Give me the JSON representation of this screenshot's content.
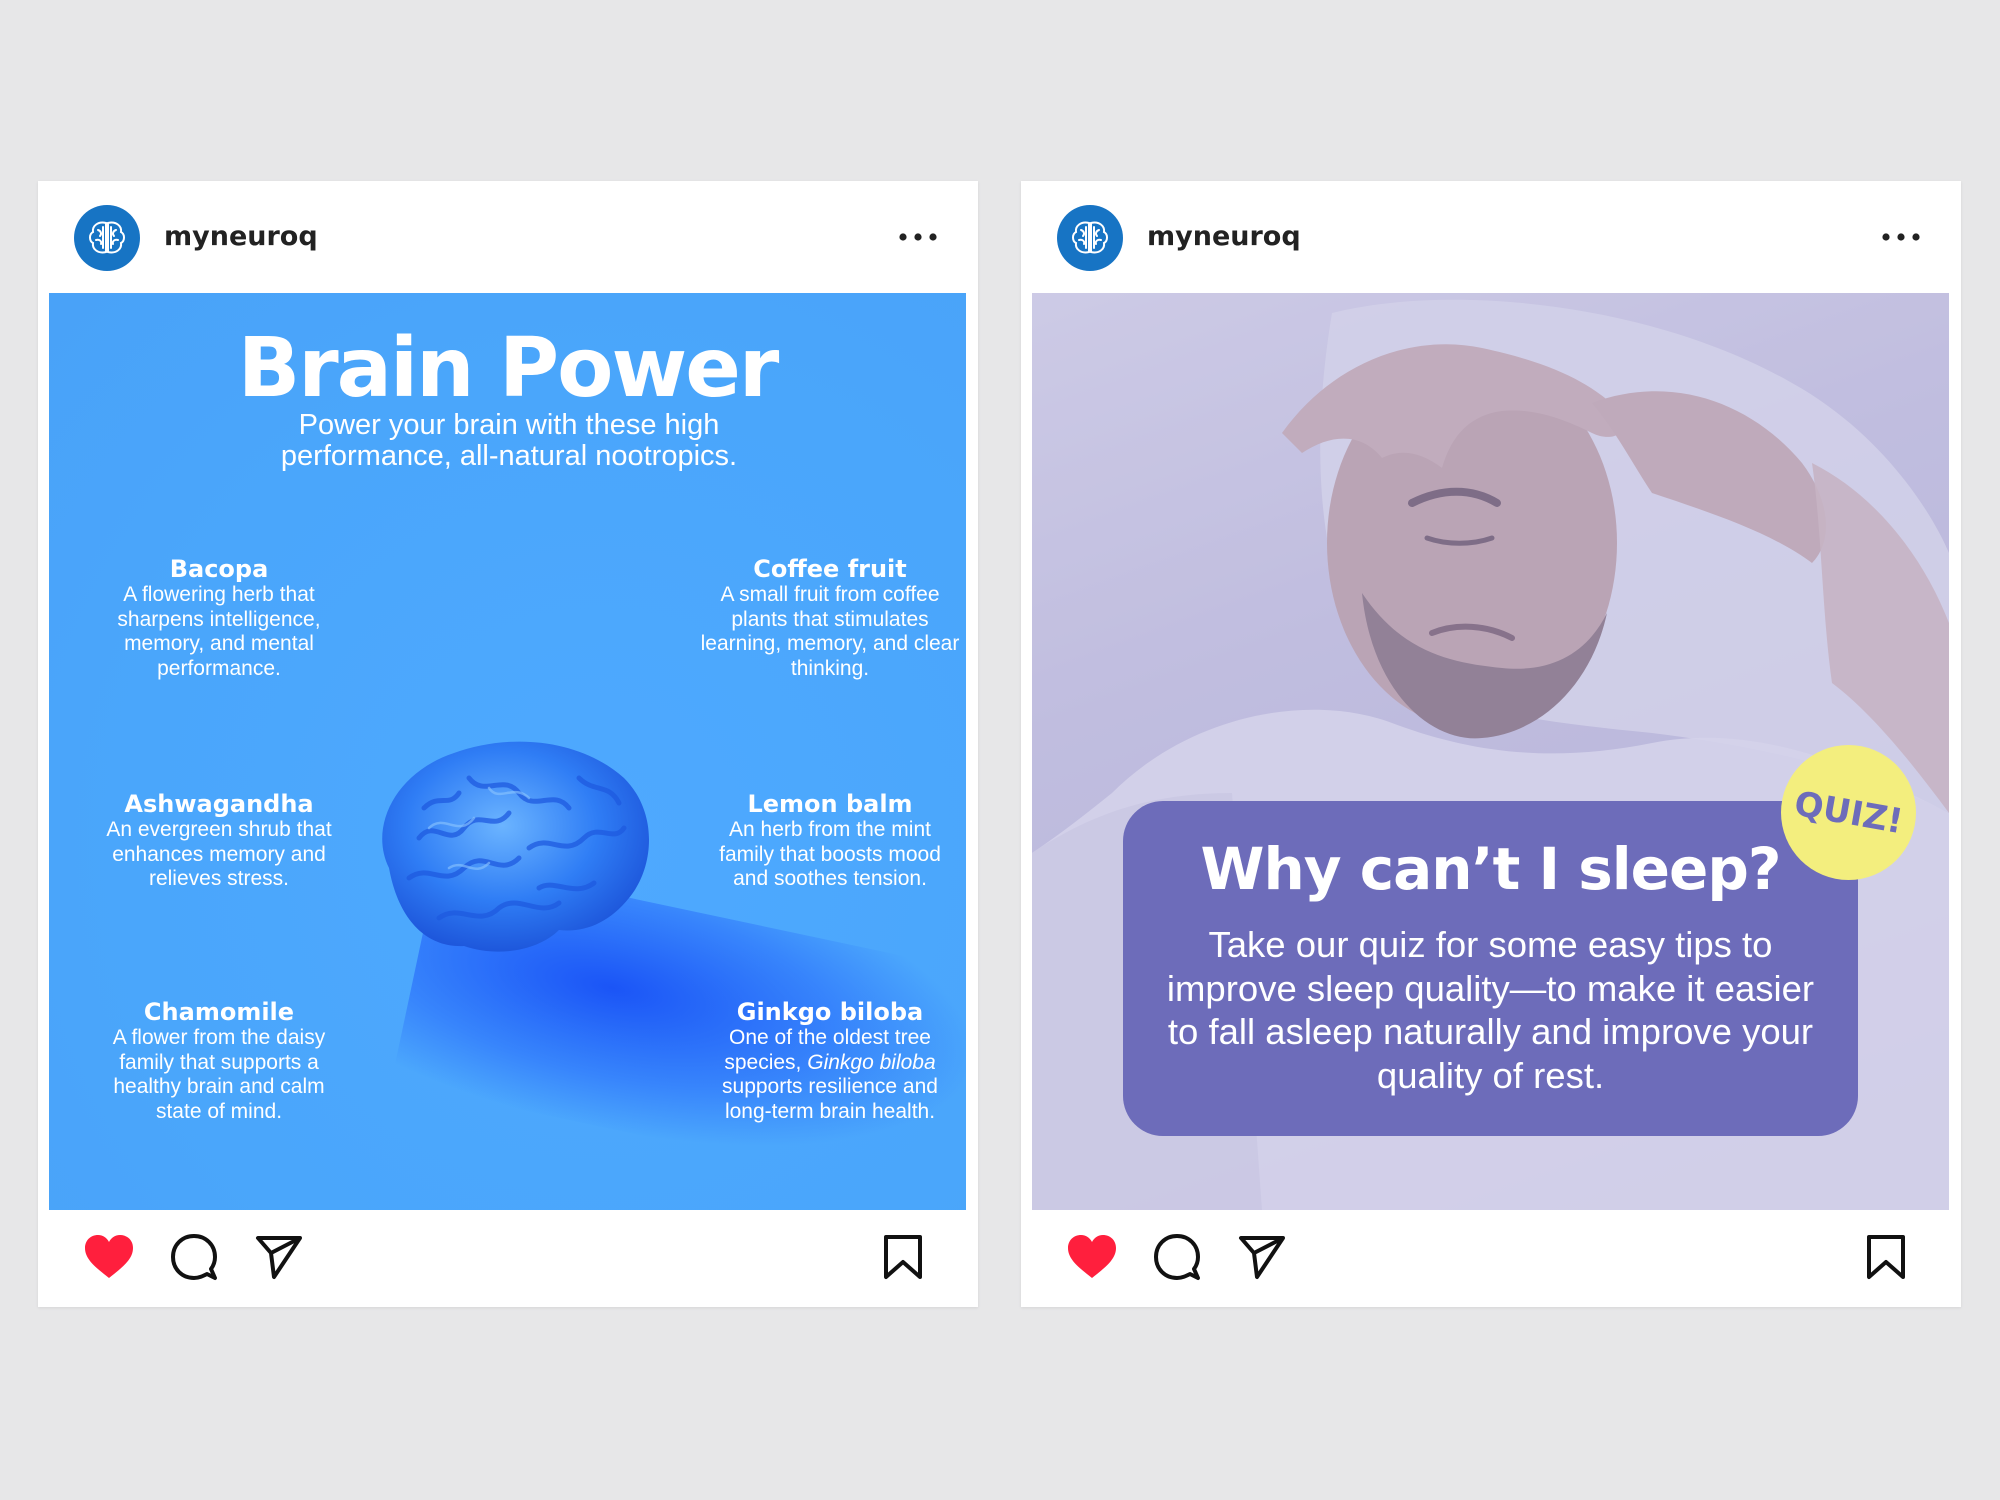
{
  "posts": [
    {
      "username": "myneuroq",
      "title": "Brain Power",
      "subtitle": "Power your brain with these high performance, all-natural nootropics.",
      "ingredients": [
        {
          "name": "Bacopa",
          "desc": "A flowering herb that sharpens intelligence, memory, and mental performance."
        },
        {
          "name": "Coffee fruit",
          "desc": "A small fruit from coffee plants that stimulates learning, memory, and clear thinking."
        },
        {
          "name": "Ashwagandha",
          "desc": "An evergreen shrub that enhances memory and relieves stress."
        },
        {
          "name": "Lemon balm",
          "desc": "An herb from the mint family that boosts mood and soothes tension."
        },
        {
          "name": "Chamomile",
          "desc": "A flower from the daisy family that supports a healthy brain and calm state of mind."
        },
        {
          "name": "Ginkgo biloba",
          "desc_before": "One of the oldest tree species,",
          "desc_italic": "Ginkgo biloba",
          "desc_after": "supports resilience and long-term brain health."
        }
      ]
    },
    {
      "username": "myneuroq",
      "title": "Why can’t I sleep?",
      "body": "Take our quiz for some easy tips to improve sleep quality—to make it easier to fall asleep naturally and improve your quality of rest.",
      "badge": "QUIZ!"
    }
  ],
  "icons": {
    "avatar": "brain-logo-icon",
    "more": "more-horizontal-icon",
    "like": "heart-icon",
    "comment": "comment-icon",
    "share": "send-icon",
    "save": "bookmark-icon"
  },
  "colors": {
    "background": "#e7e7e8",
    "brand_blue": "#1774c4",
    "post1_bg": "#4aa6fb",
    "quiz_box": "#6d6cba",
    "quiz_badge": "#f3ee7e",
    "heart": "#ff1f3d"
  }
}
